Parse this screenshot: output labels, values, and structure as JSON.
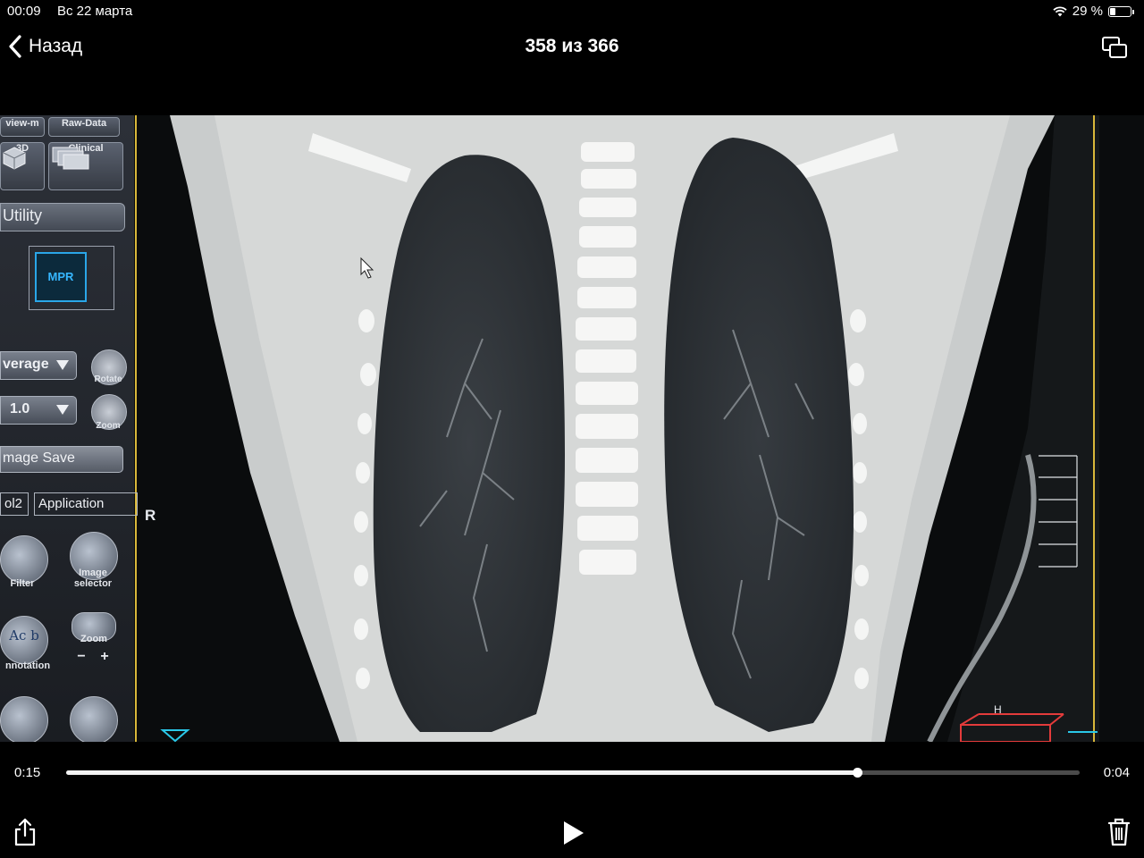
{
  "status_bar": {
    "time": "00:09",
    "date": "Вс 22 марта",
    "battery": "29 %",
    "battery_level": 0.29
  },
  "nav": {
    "back_label": "Назад",
    "counter": "358 из 366"
  },
  "screen_ui": {
    "top_tabs": [
      "view-m",
      "Raw-Data"
    ],
    "icon_labels": [
      "3D",
      "Clinical"
    ],
    "utility": "Utility",
    "mpr": "MPR",
    "combo_average": "verage",
    "combo_thickness": "1.0",
    "rotate": "Rotate",
    "zoom": "Zoom",
    "image_save": "mage Save",
    "tab_ol2": "ol2",
    "tab_application": "Application",
    "filter": "Filter",
    "image_selector_line1": "Image",
    "image_selector_line2": "selector",
    "annotation": "nnotation",
    "zoom_tool": "Zoom",
    "annotation_glyph": "Ac b",
    "minus": "−",
    "plus": "+",
    "r_marker": "R",
    "h_marker": "H"
  },
  "playback": {
    "elapsed": "0:15",
    "remaining": "0:04",
    "progress": 0.78
  }
}
